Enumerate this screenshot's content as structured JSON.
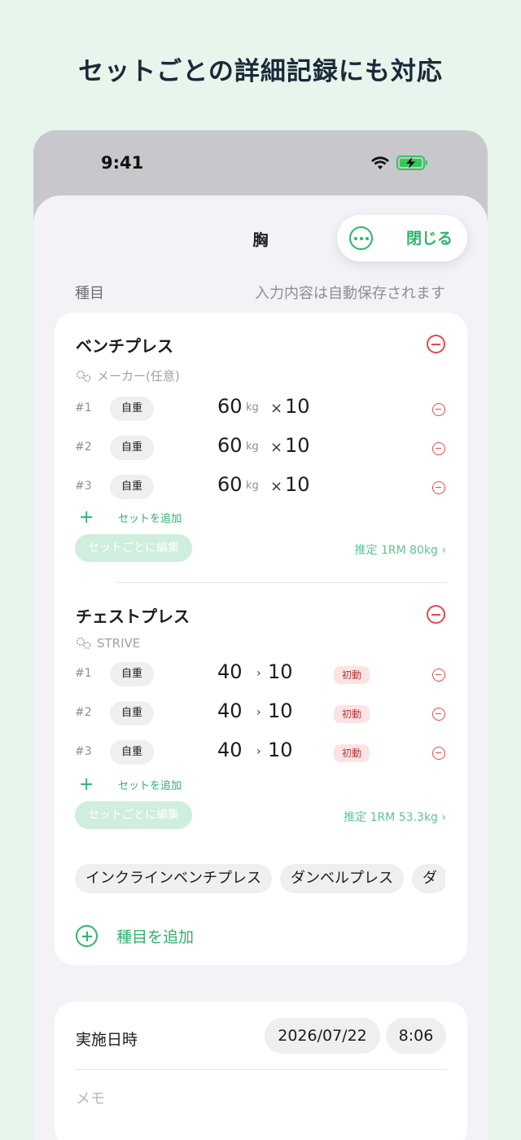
{
  "promo": {
    "title": "セットごとの詳細記録にも対応"
  },
  "status_bar": {
    "time": "9:41"
  },
  "sheet": {
    "title": "胸",
    "close_label": "閉じる"
  },
  "section": {
    "header": "種目",
    "autosave_note": "入力内容は自動保存されます"
  },
  "exercises": [
    {
      "name": "ベンチプレス",
      "maker": "メーカー(任意)",
      "sets": [
        {
          "no": "#1",
          "type": "自重",
          "weight": "60",
          "unit": "kg",
          "times": "×",
          "reps": "10"
        },
        {
          "no": "#2",
          "type": "自重",
          "weight": "60",
          "unit": "kg",
          "times": "×",
          "reps": "10"
        },
        {
          "no": "#3",
          "type": "自重",
          "weight": "60",
          "unit": "kg",
          "times": "×",
          "reps": "10"
        }
      ],
      "add_set_label": "セットを追加",
      "edit_per_set_label": "セットごとに編集",
      "estimated_rm": "推定 1RM 80kg ›"
    },
    {
      "name": "チェストプレス",
      "maker": "STRIVE",
      "sets": [
        {
          "no": "#1",
          "type": "自重",
          "weight": "40",
          "times": "›",
          "reps": "10",
          "badge": "初動"
        },
        {
          "no": "#2",
          "type": "自重",
          "weight": "40",
          "times": "›",
          "reps": "10",
          "badge": "初動"
        },
        {
          "no": "#3",
          "type": "自重",
          "weight": "40",
          "times": "›",
          "reps": "10",
          "badge": "初動"
        }
      ],
      "add_set_label": "セットを追加",
      "edit_per_set_label": "セットごとに編集",
      "estimated_rm": "推定 1RM 53.3kg ›"
    }
  ],
  "suggestions": [
    "インクラインベンチプレス",
    "ダンベルプレス",
    "ダ"
  ],
  "add_exercise_label": "種目を追加",
  "session": {
    "date_label": "実施日時",
    "date": "2026/07/22",
    "time": "8:06",
    "memo_placeholder": "メモ"
  },
  "colors": {
    "accent": "#2fb36c",
    "danger": "#e5484d",
    "background": "#e8f5ec"
  }
}
